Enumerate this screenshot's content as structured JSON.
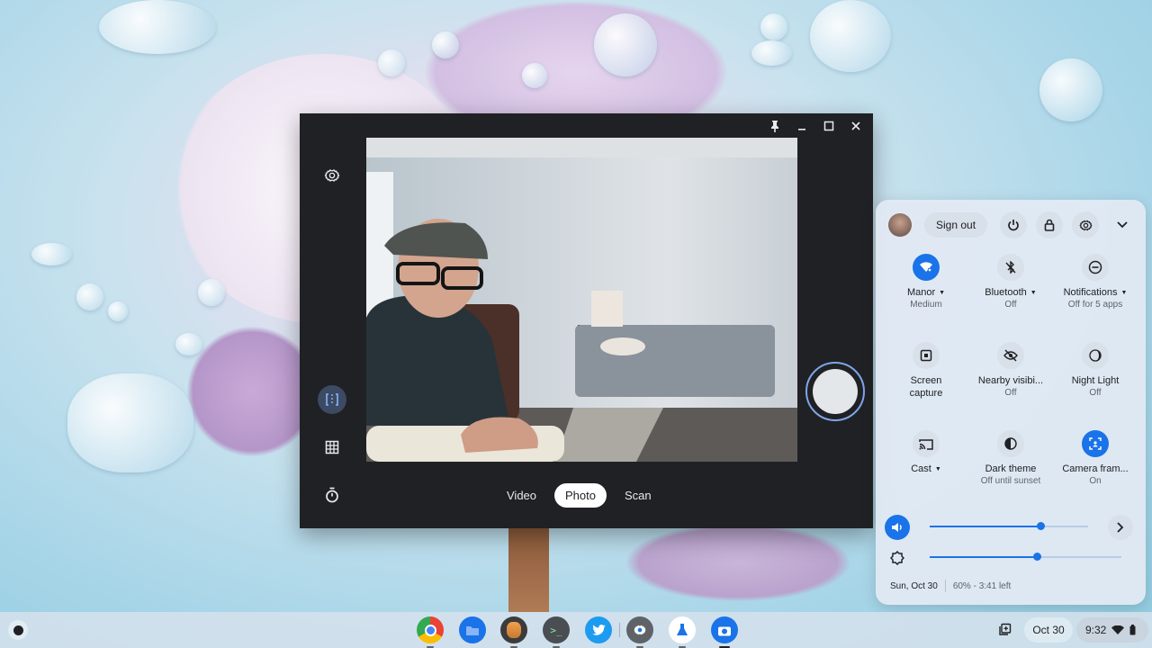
{
  "camera_app": {
    "window_controls": {
      "pin": "pin-icon",
      "minimize": "minimize-icon",
      "maximize": "maximize-icon",
      "close": "close-icon"
    },
    "side_controls": [
      "settings-icon",
      "frame-mirror-icon",
      "grid-icon",
      "timer-icon"
    ],
    "modes": [
      {
        "label": "Video",
        "active": false
      },
      {
        "label": "Photo",
        "active": true
      },
      {
        "label": "Scan",
        "active": false
      }
    ],
    "shutter_label": "Take photo"
  },
  "quick_settings": {
    "sign_out_label": "Sign out",
    "header_buttons": [
      "power-icon",
      "lock-icon",
      "settings-icon",
      "collapse-icon"
    ],
    "tiles": [
      {
        "label": "Manor",
        "sub": "Medium",
        "on": true,
        "dropdown": true,
        "icon": "wifi-icon"
      },
      {
        "label": "Bluetooth",
        "sub": "Off",
        "on": false,
        "dropdown": true,
        "icon": "bluetooth-off-icon"
      },
      {
        "label": "Notifications",
        "sub": "Off for 5 apps",
        "on": false,
        "dropdown": true,
        "icon": "do-not-disturb-icon"
      },
      {
        "label": "Screen capture",
        "sub": "",
        "on": false,
        "dropdown": false,
        "icon": "screen-capture-icon"
      },
      {
        "label": "Nearby visibi...",
        "sub": "Off",
        "on": false,
        "dropdown": false,
        "icon": "visibility-off-icon"
      },
      {
        "label": "Night Light",
        "sub": "Off",
        "on": false,
        "dropdown": false,
        "icon": "night-light-icon"
      },
      {
        "label": "Cast",
        "sub": "",
        "on": false,
        "dropdown": true,
        "icon": "cast-icon"
      },
      {
        "label": "Dark theme",
        "sub": "Off until sunset",
        "on": false,
        "dropdown": false,
        "icon": "dark-theme-icon"
      },
      {
        "label": "Camera fram...",
        "sub": "On",
        "on": true,
        "dropdown": false,
        "icon": "camera-framing-icon"
      }
    ],
    "volume_percent": 70,
    "brightness_percent": 56,
    "date": "Sun, Oct 30",
    "battery": "60% - 3:41 left",
    "accent": "#1a73e8"
  },
  "shelf": {
    "apps": [
      "Chrome",
      "Files",
      "Photo app",
      "Terminal",
      "Twitter",
      "Settings",
      "Labs",
      "Camera"
    ],
    "date": "Oct 30",
    "time": "9:32"
  }
}
